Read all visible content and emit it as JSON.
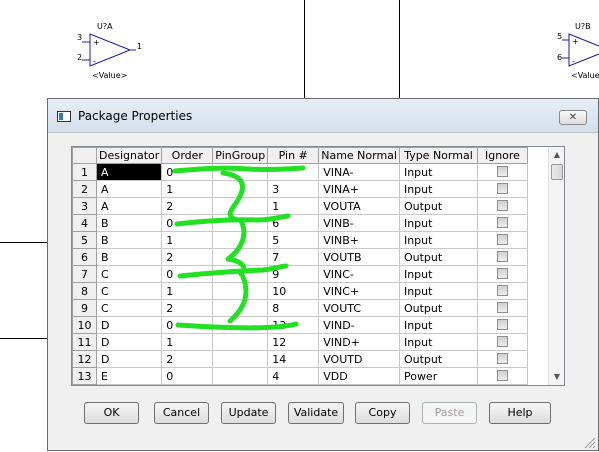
{
  "schematic": {
    "part_a": {
      "refdes": "U?A",
      "pin_plus": "3",
      "pin_minus": "2",
      "pin_out": "1",
      "value": "<Value>",
      "plus_sign": "+",
      "minus_sign": "-"
    },
    "part_b": {
      "refdes": "U?B",
      "pin_plus": "5",
      "pin_minus": "6",
      "value": "<Value>",
      "plus_sign": "+",
      "minus_sign": "-"
    }
  },
  "dialog": {
    "title": "Package Properties",
    "close_label": "✕",
    "columns": [
      "Designator",
      "Order",
      "PinGroup",
      "Pin #",
      "Name Normal",
      "Type Normal",
      "Ignore"
    ],
    "rows": [
      {
        "num": "1",
        "designator": "A",
        "order": "0",
        "pingroup": "",
        "pin": "",
        "name": "VINA-",
        "type": "Input"
      },
      {
        "num": "2",
        "designator": "A",
        "order": "1",
        "pingroup": "",
        "pin": "3",
        "name": "VINA+",
        "type": "Input"
      },
      {
        "num": "3",
        "designator": "A",
        "order": "2",
        "pingroup": "",
        "pin": "1",
        "name": "VOUTA",
        "type": "Output"
      },
      {
        "num": "4",
        "designator": "B",
        "order": "0",
        "pingroup": "",
        "pin": "6",
        "name": "VINB-",
        "type": "Input"
      },
      {
        "num": "5",
        "designator": "B",
        "order": "1",
        "pingroup": "",
        "pin": "5",
        "name": "VINB+",
        "type": "Input"
      },
      {
        "num": "6",
        "designator": "B",
        "order": "2",
        "pingroup": "",
        "pin": "7",
        "name": "VOUTB",
        "type": "Output"
      },
      {
        "num": "7",
        "designator": "C",
        "order": "0",
        "pingroup": "",
        "pin": "9",
        "name": "VINC-",
        "type": "Input"
      },
      {
        "num": "8",
        "designator": "C",
        "order": "1",
        "pingroup": "",
        "pin": "10",
        "name": "VINC+",
        "type": "Input"
      },
      {
        "num": "9",
        "designator": "C",
        "order": "2",
        "pingroup": "",
        "pin": "8",
        "name": "VOUTC",
        "type": "Output"
      },
      {
        "num": "10",
        "designator": "D",
        "order": "0",
        "pingroup": "",
        "pin": "13",
        "name": "VIND-",
        "type": "Input"
      },
      {
        "num": "11",
        "designator": "D",
        "order": "1",
        "pingroup": "",
        "pin": "12",
        "name": "VIND+",
        "type": "Input"
      },
      {
        "num": "12",
        "designator": "D",
        "order": "2",
        "pingroup": "",
        "pin": "14",
        "name": "VOUTD",
        "type": "Output"
      },
      {
        "num": "13",
        "designator": "E",
        "order": "0",
        "pingroup": "",
        "pin": "4",
        "name": "VDD",
        "type": "Power"
      },
      {
        "num": "14",
        "designator": "E",
        "order": "1",
        "pingroup": "",
        "pin": "11",
        "name": "VSS",
        "type": "Power"
      }
    ],
    "buttons": {
      "ok": "OK",
      "cancel": "Cancel",
      "update": "Update",
      "validate": "Validate",
      "copy": "Copy",
      "paste": "Paste",
      "help": "Help"
    }
  },
  "colors": {
    "annotation": "#22e022",
    "selection": "#000000",
    "symbol": "#1a1aa6"
  }
}
